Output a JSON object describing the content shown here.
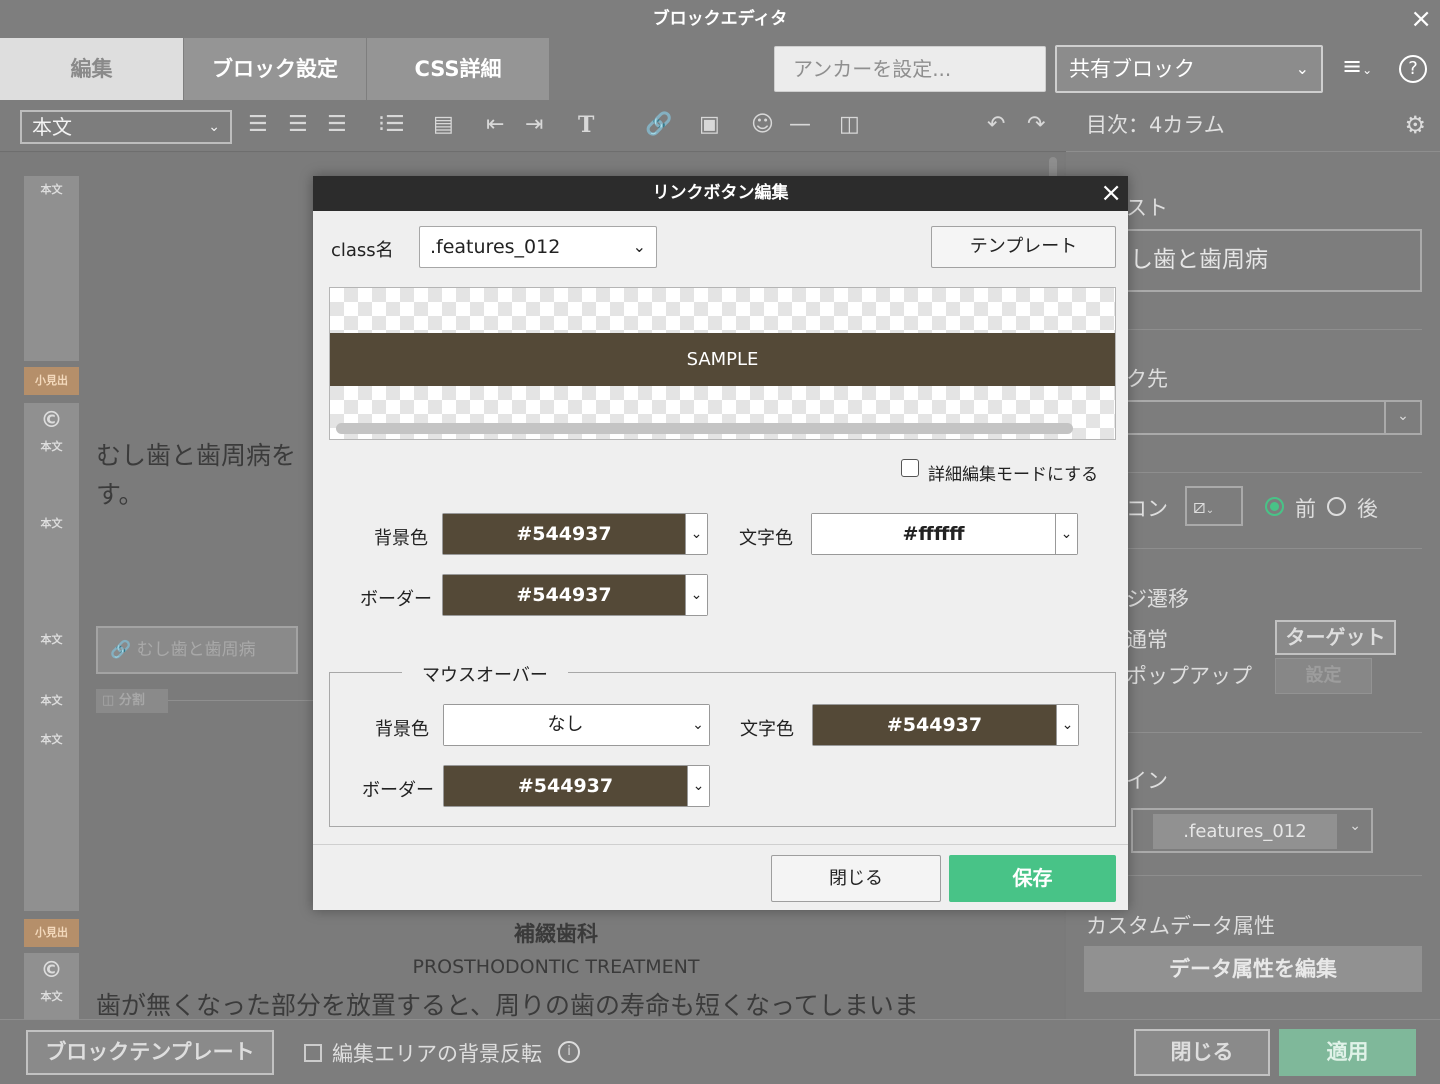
{
  "window": {
    "title": "ブロックエディタ",
    "close_icon": "×"
  },
  "tabs": [
    {
      "label": "編集",
      "active": true
    },
    {
      "label": "ブロック設定",
      "active": false
    },
    {
      "label": "CSS詳細",
      "active": false
    }
  ],
  "header": {
    "anchor_placeholder": "アンカーを設定...",
    "shared_block": "共有ブロック",
    "menu_icon": "≡",
    "help_icon": "?"
  },
  "toolbar": {
    "style_select": "本文"
  },
  "editor": {
    "gutter_tags": {
      "body": "本文",
      "subheading": "小見出"
    },
    "paragraph_1": "むし歯と歯周病を",
    "paragraph_1b": "す。",
    "link_button_text": "むし歯と歯周病",
    "split_label": "分割",
    "heading_2": "補綴歯科",
    "heading_2_en": "PROSTHODONTIC TREATMENT",
    "paragraph_2": "歯が無くなった部分を放置すると、周りの歯の寿命も短くなってしまいま"
  },
  "right_panel": {
    "title": "目次：4カラム",
    "text_label": "スト",
    "text_value": "し歯と歯周病",
    "link_label": "ク先",
    "icon_label": "コン",
    "position_before": "前",
    "position_after": "後",
    "page_transition_label": "ジ遷移",
    "normal_label": "通常",
    "popup_label": "ポップアップ",
    "target_button": "ターゲット",
    "settings_button": "設定",
    "design_label": "イン",
    "design_value": ".features_012",
    "custom_data_label": "カスタムデータ属性",
    "edit_data_button": "データ属性を編集"
  },
  "bottom": {
    "block_template": "ブロックテンプレート",
    "invert_bg": "編集エリアの背景反転",
    "info_icon": "i",
    "close": "閉じる",
    "apply": "適用"
  },
  "modal": {
    "title": "リンクボタン編集",
    "close_icon": "×",
    "class_label": "class名",
    "class_value": ".features_012",
    "template_button": "テンプレート",
    "sample_text": "SAMPLE",
    "detail_mode_label": "詳細編集モードにする",
    "bg_color_label": "背景色",
    "bg_color": "#544937",
    "text_color_label": "文字色",
    "text_color": "#ffffff",
    "border_label": "ボーダー",
    "border_color": "#544937",
    "mouseover_legend": "マウスオーバー",
    "hover_bg_label": "背景色",
    "hover_bg": "なし",
    "hover_text_label": "文字色",
    "hover_text": "#544937",
    "hover_border_label": "ボーダー",
    "hover_border": "#544937",
    "close_button": "閉じる",
    "save_button": "保存"
  },
  "colors": {
    "accent_green": "#48c387",
    "button_brown": "#544937"
  }
}
